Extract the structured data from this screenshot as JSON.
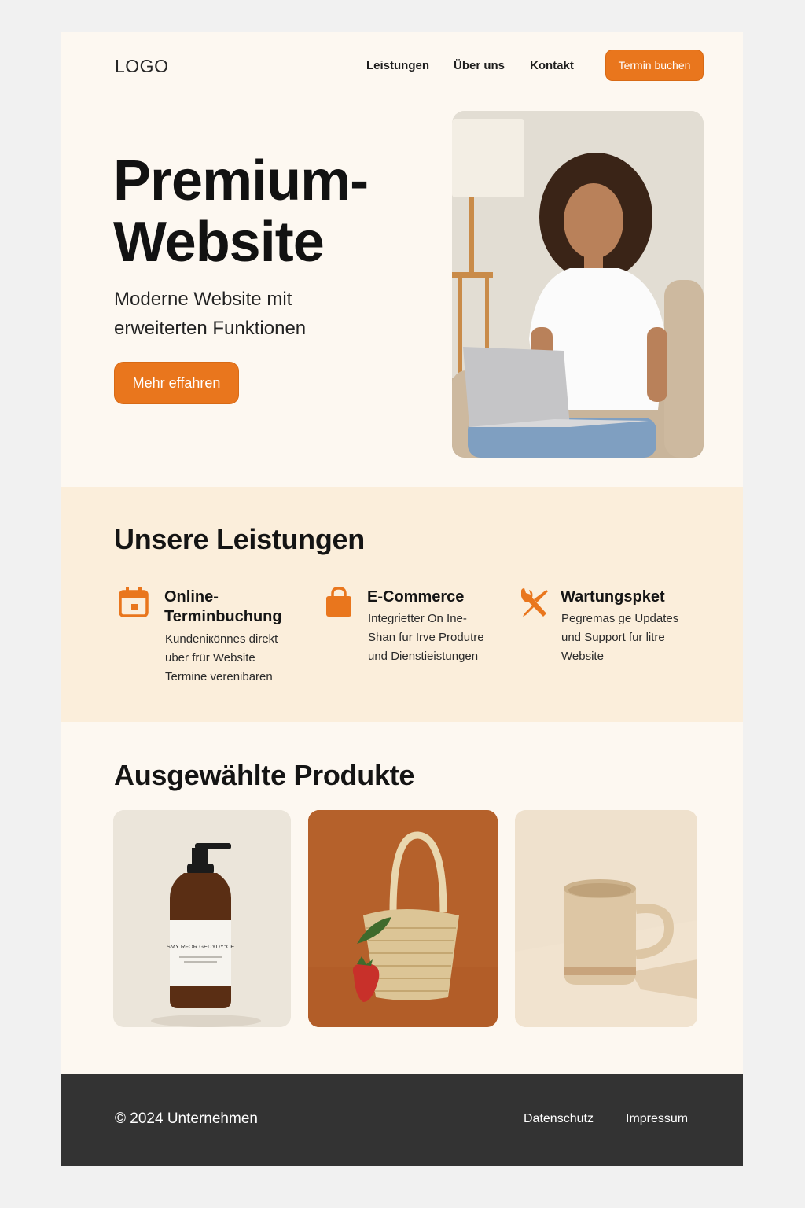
{
  "header": {
    "logo": "LOGO",
    "nav": [
      "Leistungen",
      "Über uns",
      "Kontakt"
    ],
    "cta": "Termin buchen"
  },
  "hero": {
    "title_line1": "Premium-",
    "title_line2": "Website",
    "subtitle": "Moderne Website mit erweiterten Funktionen",
    "cta": "Mehr effahren",
    "image": "woman-with-laptop-photo"
  },
  "services": {
    "title": "Unsere Leistungen",
    "items": [
      {
        "icon": "calendar-icon",
        "title": "Online-Terminbuchung",
        "desc": "Kundeniкönnes direkt uber frür Website Termine verenibaren"
      },
      {
        "icon": "shopping-bag-icon",
        "title": "E-Commerce",
        "desc": "Integrietter On Ine-Shan fur Irve Produtre und Dienstieistungen"
      },
      {
        "icon": "tools-icon",
        "title": "Wartungspket",
        "desc": "Pegremas ge Updates und Support fur litre Website"
      }
    ]
  },
  "products": {
    "title": "Ausgewählte Produkte",
    "items": [
      {
        "image": "amber-pump-bottle-photo",
        "label_text": "SMY RFOR GEDYDY°CE"
      },
      {
        "image": "woven-basket-bag-photo"
      },
      {
        "image": "ceramic-mug-photo"
      }
    ]
  },
  "footer": {
    "copyright": "© 2024 Unternehmen",
    "links": [
      "Datenschutz",
      "Impressum"
    ]
  },
  "colors": {
    "accent": "#e9761d",
    "page_bg": "#fdf8f1",
    "services_bg": "#fbeedb",
    "footer_bg": "#333333"
  }
}
